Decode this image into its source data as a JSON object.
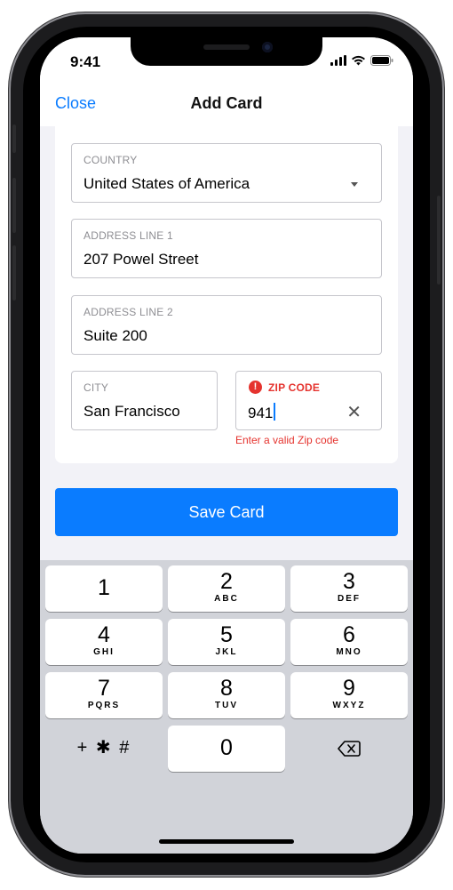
{
  "status_bar": {
    "time": "9:41"
  },
  "nav": {
    "close_label": "Close",
    "title": "Add Card"
  },
  "form": {
    "country": {
      "label": "COUNTRY",
      "value": "United States of America"
    },
    "address1": {
      "label": "ADDRESS LINE 1",
      "value": "207 Powel Street"
    },
    "address2": {
      "label": "ADDRESS LINE 2",
      "value": "Suite 200"
    },
    "city": {
      "label": "CITY",
      "value": "San Francisco"
    },
    "zip": {
      "label": "ZIP CODE",
      "value": "941",
      "error": "Enter a valid Zip code",
      "error_icon": "!"
    }
  },
  "save_label": "Save Card",
  "keypad": {
    "keys": [
      {
        "num": "1",
        "letters": ""
      },
      {
        "num": "2",
        "letters": "ABC"
      },
      {
        "num": "3",
        "letters": "DEF"
      },
      {
        "num": "4",
        "letters": "GHI"
      },
      {
        "num": "5",
        "letters": "JKL"
      },
      {
        "num": "6",
        "letters": "MNO"
      },
      {
        "num": "7",
        "letters": "PQRS"
      },
      {
        "num": "8",
        "letters": "TUV"
      },
      {
        "num": "9",
        "letters": "WXYZ"
      },
      {
        "num": "0",
        "letters": ""
      }
    ],
    "symbols_label": "+ ✱ #"
  },
  "colors": {
    "accent": "#0a7cff",
    "error": "#e5332e",
    "keypad_bg": "#d1d3d9"
  }
}
